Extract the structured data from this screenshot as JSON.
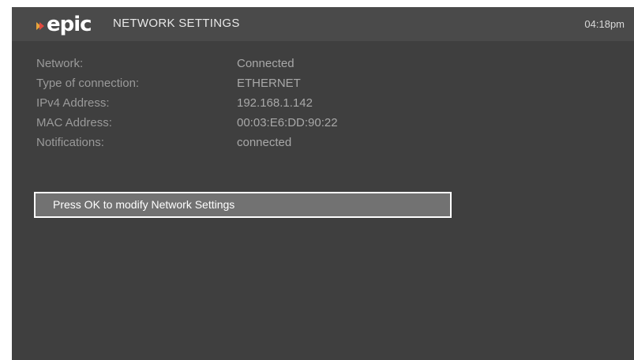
{
  "header": {
    "logo_text": "epic",
    "title": "NETWORK SETTINGS",
    "time": "04:18pm"
  },
  "colors": {
    "header_bg": "#4a4a4a",
    "screen_bg": "#3f3f3f",
    "logo_mark_orange": "#e8a33a",
    "logo_mark_red": "#e0493f",
    "button_bg": "#727272",
    "button_border": "#ffffff"
  },
  "network_info": {
    "rows": [
      {
        "label": "Network:",
        "value": "Connected"
      },
      {
        "label": "Type of connection:",
        "value": "ETHERNET"
      },
      {
        "label": "IPv4 Address:",
        "value": "192.168.1.142"
      },
      {
        "label": "MAC Address:",
        "value": "00:03:E6:DD:90:22"
      },
      {
        "label": "Notifications:",
        "value": "connected"
      }
    ]
  },
  "action": {
    "label": "Press OK to modify Network Settings"
  }
}
